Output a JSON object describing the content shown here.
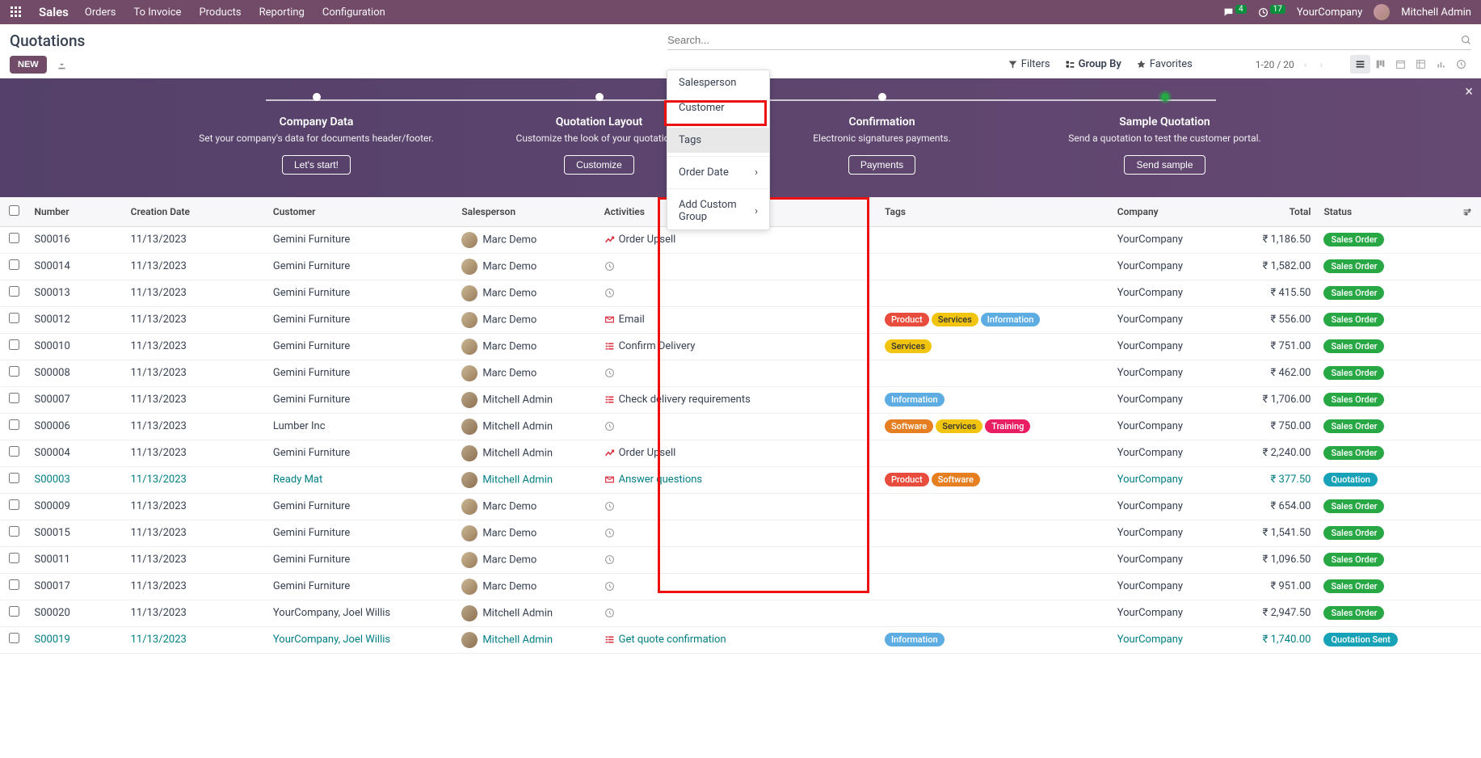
{
  "navbar": {
    "brand": "Sales",
    "menu": [
      "Orders",
      "To Invoice",
      "Products",
      "Reporting",
      "Configuration"
    ],
    "chat_badge": "4",
    "clock_badge": "17",
    "company": "YourCompany",
    "user": "Mitchell Admin"
  },
  "breadcrumb": {
    "title": "Quotations"
  },
  "search": {
    "placeholder": "Search..."
  },
  "buttons": {
    "new": "NEW"
  },
  "search_opts": {
    "filters": "Filters",
    "groupby": "Group By",
    "favorites": "Favorites"
  },
  "pager": {
    "current": "1-20",
    "sep": "/",
    "total": "20"
  },
  "dropdown": {
    "salesperson": "Salesperson",
    "customer": "Customer",
    "tags": "Tags",
    "orderdate": "Order Date",
    "addcustom": "Add Custom Group"
  },
  "onboarding": {
    "steps": [
      {
        "title": "Company Data",
        "desc": "Set your company's data for documents header/footer.",
        "btn": "Let's start!"
      },
      {
        "title": "Quotation Layout",
        "desc": "Customize the look of your quotations.",
        "btn": "Customize"
      },
      {
        "title": "Confirmation",
        "desc": "Electronic signatures payments.",
        "btn": "Payments"
      },
      {
        "title": "Sample Quotation",
        "desc": "Send a quotation to test the customer portal.",
        "btn": "Send sample"
      }
    ]
  },
  "columns": {
    "number": "Number",
    "creation": "Creation Date",
    "customer": "Customer",
    "salesperson": "Salesperson",
    "activities": "Activities",
    "tags": "Tags",
    "company": "Company",
    "total": "Total",
    "status": "Status"
  },
  "tag_labels": {
    "product": "Product",
    "services": "Services",
    "information": "Information",
    "software": "Software",
    "training": "Training"
  },
  "status_labels": {
    "salesorder": "Sales Order",
    "quotation": "Quotation",
    "quotationsent": "Quotation Sent"
  },
  "rows": [
    {
      "number": "S00016",
      "creation": "11/13/2023",
      "customer": "Gemini Furniture",
      "salesperson": "Marc Demo",
      "activity": {
        "type": "upsell",
        "label": "Order Upsell"
      },
      "tags": [],
      "company": "YourCompany",
      "total": "₹ 1,186.50",
      "status": "salesorder",
      "link": false
    },
    {
      "number": "S00014",
      "creation": "11/13/2023",
      "customer": "Gemini Furniture",
      "salesperson": "Marc Demo",
      "activity": {
        "type": "clock",
        "label": ""
      },
      "tags": [],
      "company": "YourCompany",
      "total": "₹ 1,582.00",
      "status": "salesorder",
      "link": false
    },
    {
      "number": "S00013",
      "creation": "11/13/2023",
      "customer": "Gemini Furniture",
      "salesperson": "Marc Demo",
      "activity": {
        "type": "clock",
        "label": ""
      },
      "tags": [],
      "company": "YourCompany",
      "total": "₹ 415.50",
      "status": "salesorder",
      "link": false
    },
    {
      "number": "S00012",
      "creation": "11/13/2023",
      "customer": "Gemini Furniture",
      "salesperson": "Marc Demo",
      "activity": {
        "type": "email",
        "label": "Email"
      },
      "tags": [
        "product",
        "services",
        "information"
      ],
      "company": "YourCompany",
      "total": "₹ 556.00",
      "status": "salesorder",
      "link": false
    },
    {
      "number": "S00010",
      "creation": "11/13/2023",
      "customer": "Gemini Furniture",
      "salesperson": "Marc Demo",
      "activity": {
        "type": "list",
        "label": "Confirm Delivery"
      },
      "tags": [
        "services"
      ],
      "company": "YourCompany",
      "total": "₹ 751.00",
      "status": "salesorder",
      "link": false
    },
    {
      "number": "S00008",
      "creation": "11/13/2023",
      "customer": "Gemini Furniture",
      "salesperson": "Marc Demo",
      "activity": {
        "type": "clock",
        "label": ""
      },
      "tags": [],
      "company": "YourCompany",
      "total": "₹ 462.00",
      "status": "salesorder",
      "link": false
    },
    {
      "number": "S00007",
      "creation": "11/13/2023",
      "customer": "Gemini Furniture",
      "salesperson": "Mitchell Admin",
      "activity": {
        "type": "list",
        "label": "Check delivery requirements"
      },
      "tags": [
        "information"
      ],
      "company": "YourCompany",
      "total": "₹ 1,706.00",
      "status": "salesorder",
      "link": false
    },
    {
      "number": "S00006",
      "creation": "11/13/2023",
      "customer": "Lumber Inc",
      "salesperson": "Mitchell Admin",
      "activity": {
        "type": "clock",
        "label": ""
      },
      "tags": [
        "software",
        "services",
        "training"
      ],
      "company": "YourCompany",
      "total": "₹ 750.00",
      "status": "salesorder",
      "link": false
    },
    {
      "number": "S00004",
      "creation": "11/13/2023",
      "customer": "Gemini Furniture",
      "salesperson": "Mitchell Admin",
      "activity": {
        "type": "upsell",
        "label": "Order Upsell"
      },
      "tags": [],
      "company": "YourCompany",
      "total": "₹ 2,240.00",
      "status": "salesorder",
      "link": false
    },
    {
      "number": "S00003",
      "creation": "11/13/2023",
      "customer": "Ready Mat",
      "salesperson": "Mitchell Admin",
      "activity": {
        "type": "email",
        "label": "Answer questions"
      },
      "tags": [
        "product",
        "software"
      ],
      "company": "YourCompany",
      "total": "₹ 377.50",
      "status": "quotation",
      "link": true
    },
    {
      "number": "S00009",
      "creation": "11/13/2023",
      "customer": "Gemini Furniture",
      "salesperson": "Marc Demo",
      "activity": {
        "type": "clock",
        "label": ""
      },
      "tags": [],
      "company": "YourCompany",
      "total": "₹ 654.00",
      "status": "salesorder",
      "link": false
    },
    {
      "number": "S00015",
      "creation": "11/13/2023",
      "customer": "Gemini Furniture",
      "salesperson": "Marc Demo",
      "activity": {
        "type": "clock",
        "label": ""
      },
      "tags": [],
      "company": "YourCompany",
      "total": "₹ 1,541.50",
      "status": "salesorder",
      "link": false
    },
    {
      "number": "S00011",
      "creation": "11/13/2023",
      "customer": "Gemini Furniture",
      "salesperson": "Marc Demo",
      "activity": {
        "type": "clock",
        "label": ""
      },
      "tags": [],
      "company": "YourCompany",
      "total": "₹ 1,096.50",
      "status": "salesorder",
      "link": false
    },
    {
      "number": "S00017",
      "creation": "11/13/2023",
      "customer": "Gemini Furniture",
      "salesperson": "Marc Demo",
      "activity": {
        "type": "clock",
        "label": ""
      },
      "tags": [],
      "company": "YourCompany",
      "total": "₹ 951.00",
      "status": "salesorder",
      "link": false
    },
    {
      "number": "S00020",
      "creation": "11/13/2023",
      "customer": "YourCompany, Joel Willis",
      "salesperson": "Mitchell Admin",
      "activity": {
        "type": "clock",
        "label": ""
      },
      "tags": [],
      "company": "YourCompany",
      "total": "₹ 2,947.50",
      "status": "salesorder",
      "link": false
    },
    {
      "number": "S00019",
      "creation": "11/13/2023",
      "customer": "YourCompany, Joel Willis",
      "salesperson": "Mitchell Admin",
      "activity": {
        "type": "list",
        "label": "Get quote confirmation"
      },
      "tags": [
        "information"
      ],
      "company": "YourCompany",
      "total": "₹ 1,740.00",
      "status": "quotationsent",
      "link": true
    }
  ]
}
